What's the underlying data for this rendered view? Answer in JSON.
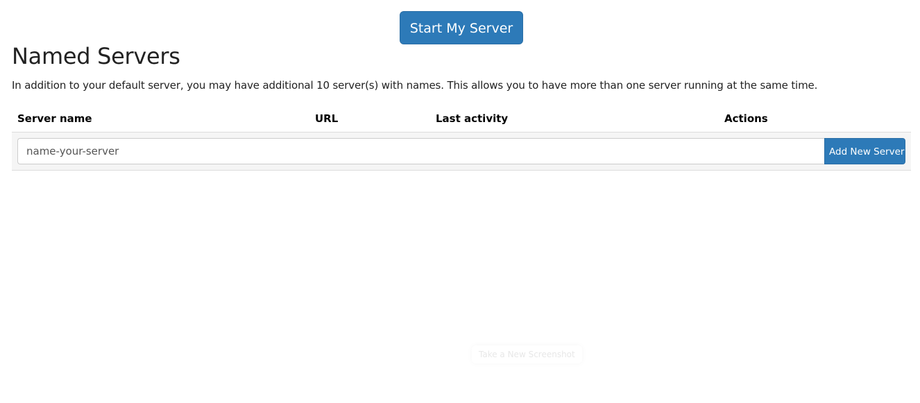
{
  "header": {
    "start_button_label": "Start My Server"
  },
  "section": {
    "title": "Named Servers",
    "description": "In addition to your default server, you may have additional 10 server(s) with names. This allows you to have more than one server running at the same time."
  },
  "table": {
    "columns": {
      "server_name": "Server name",
      "url": "URL",
      "last_activity": "Last activity",
      "actions": "Actions"
    },
    "new_server_row": {
      "placeholder": "name-your-server",
      "value": "",
      "add_button_label": "Add New Server"
    }
  },
  "overlay": {
    "screenshot_hint": "Take a New Screenshot"
  },
  "colors": {
    "primary": "#2d7ab8",
    "row_background": "#f5f5f5"
  }
}
